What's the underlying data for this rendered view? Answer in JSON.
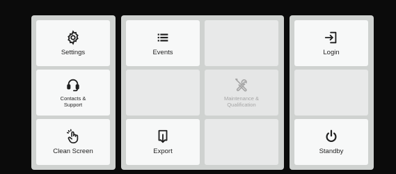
{
  "menu": {
    "settings": {
      "label": "Settings",
      "icon": "gear-icon"
    },
    "contacts_support": {
      "label": "Contacts &\nSupport",
      "icon": "headset-icon"
    },
    "clean_screen": {
      "label": "Clean Screen",
      "icon": "hand-tap-icon"
    },
    "events": {
      "label": "Events",
      "icon": "list-icon"
    },
    "export": {
      "label": "Export",
      "icon": "export-icon"
    },
    "maintenance": {
      "label": "Maintenance &\nQualification",
      "icon": "wrench-screwdriver-icon",
      "state": "disabled"
    },
    "login": {
      "label": "Login",
      "icon": "login-icon"
    },
    "standby": {
      "label": "Standby",
      "icon": "power-icon"
    }
  },
  "colors": {
    "background": "#0b0b0b",
    "panel": "#cfd2d0",
    "tile": "#f7f8f8",
    "tile_empty": "#e8e9e9",
    "text": "#1f1f1f",
    "text_disabled": "#a6a6a6"
  }
}
